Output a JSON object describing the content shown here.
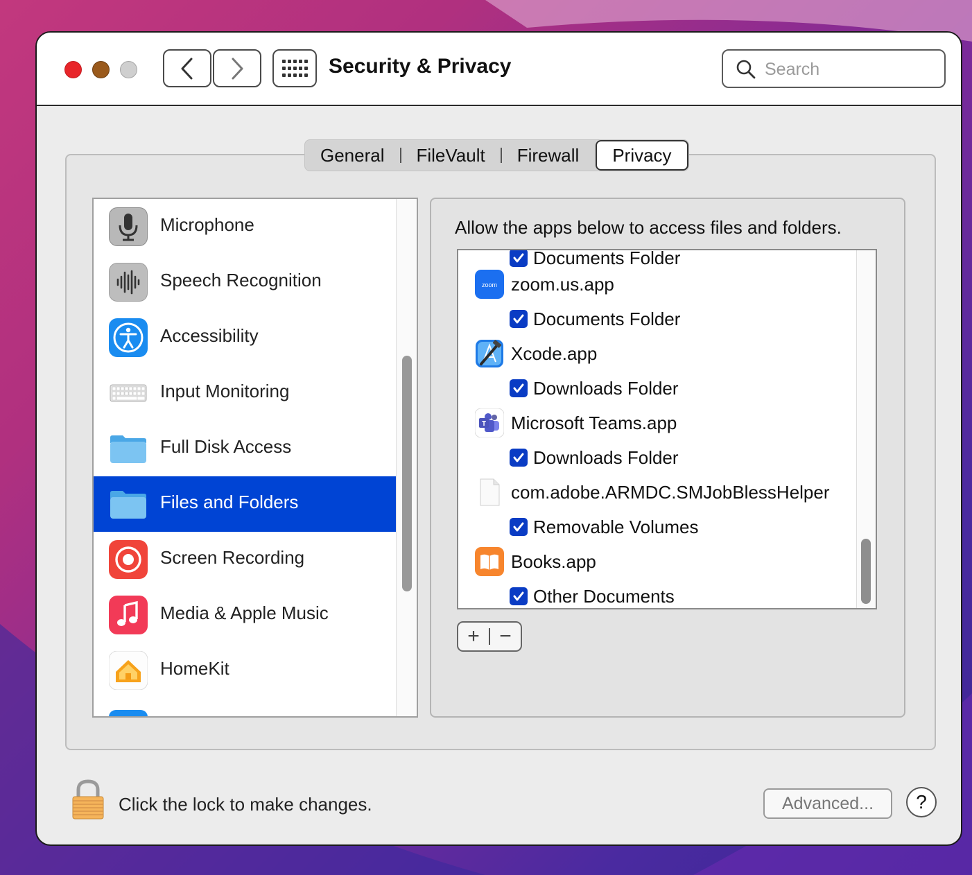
{
  "window": {
    "title": "Security & Privacy",
    "search_placeholder": "Search"
  },
  "tabs": [
    {
      "label": "General",
      "active": false
    },
    {
      "label": "FileVault",
      "active": false
    },
    {
      "label": "Firewall",
      "active": false
    },
    {
      "label": "Privacy",
      "active": true
    }
  ],
  "categories": [
    {
      "label": "Microphone",
      "icon": "microphone-icon"
    },
    {
      "label": "Speech Recognition",
      "icon": "waveform-icon"
    },
    {
      "label": "Accessibility",
      "icon": "accessibility-icon"
    },
    {
      "label": "Input Monitoring",
      "icon": "keyboard-icon"
    },
    {
      "label": "Full Disk Access",
      "icon": "folder-icon"
    },
    {
      "label": "Files and Folders",
      "icon": "folder-icon",
      "selected": true
    },
    {
      "label": "Screen Recording",
      "icon": "record-icon"
    },
    {
      "label": "Media & Apple Music",
      "icon": "music-note-icon"
    },
    {
      "label": "HomeKit",
      "icon": "home-icon"
    }
  ],
  "panel": {
    "description": "Allow the apps below to access files and folders.",
    "entries": [
      {
        "type": "permission",
        "label": "Documents Folder",
        "checked": true
      },
      {
        "type": "app",
        "label": "zoom.us.app",
        "icon": "zoom-app-icon"
      },
      {
        "type": "permission",
        "label": "Documents Folder",
        "checked": true
      },
      {
        "type": "app",
        "label": "Xcode.app",
        "icon": "xcode-app-icon"
      },
      {
        "type": "permission",
        "label": "Downloads Folder",
        "checked": true
      },
      {
        "type": "app",
        "label": "Microsoft Teams.app",
        "icon": "teams-app-icon"
      },
      {
        "type": "permission",
        "label": "Downloads Folder",
        "checked": true
      },
      {
        "type": "app",
        "label": "com.adobe.ARMDC.SMJobBlessHelper",
        "icon": "generic-file-icon"
      },
      {
        "type": "permission",
        "label": "Removable Volumes",
        "checked": true
      },
      {
        "type": "app",
        "label": "Books.app",
        "icon": "books-app-icon"
      },
      {
        "type": "permission",
        "label": "Other Documents",
        "checked": true
      }
    ],
    "add_label": "+",
    "remove_label": "−"
  },
  "footer": {
    "lock_text": "Click the lock to make changes.",
    "advanced_label": "Advanced...",
    "help_label": "?"
  },
  "colors": {
    "selection": "#0044d4",
    "checkbox": "#0a3cc4",
    "close": "#e8252a",
    "minimize": "#9a5a1c",
    "zoom": "#c8c8c8"
  }
}
